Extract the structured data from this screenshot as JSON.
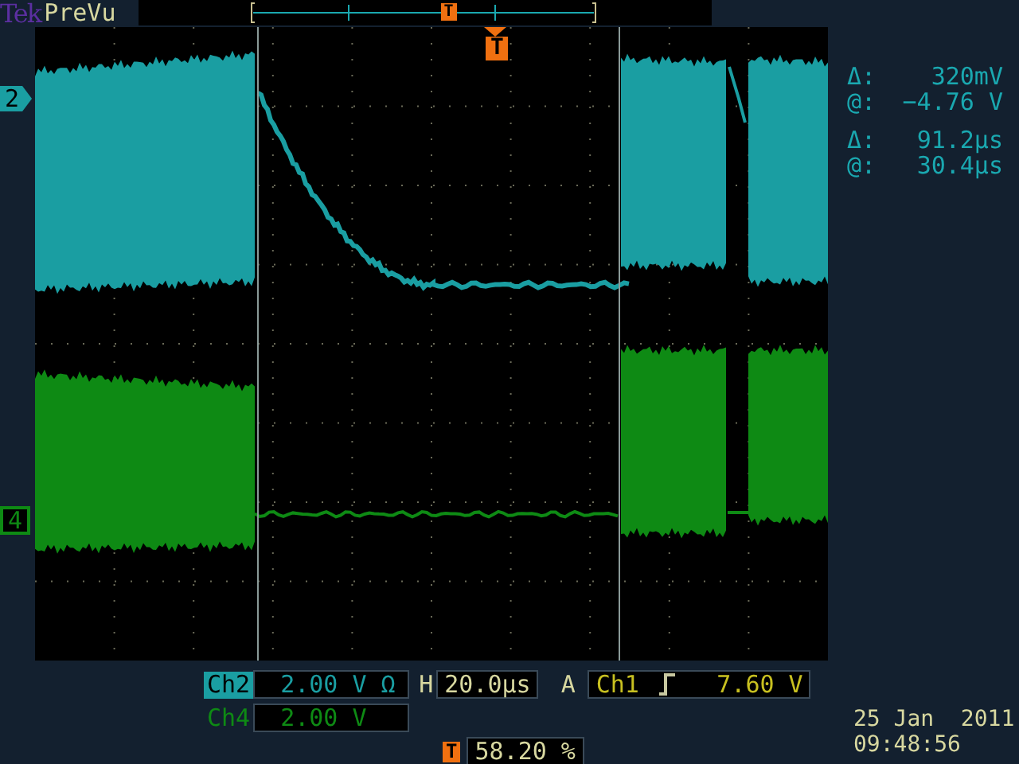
{
  "header": {
    "brand": "Tek",
    "mode": "PreVu"
  },
  "record_view": {
    "trigger_marker": "T"
  },
  "trigger_marker": "T",
  "channel_markers": [
    {
      "label": "2",
      "color": "#1a9ea2"
    },
    {
      "label": "4",
      "color": "#0e8a14"
    }
  ],
  "readouts": [
    {
      "label": "Δ:",
      "value": "320mV"
    },
    {
      "label": "@:",
      "value": "−4.76 V"
    },
    {
      "label": "Δ:",
      "value": "91.2µs"
    },
    {
      "label": "@:",
      "value": "30.4µs"
    }
  ],
  "channels": [
    {
      "name": "Ch2",
      "scale": "2.00 V Ω",
      "selected": true,
      "color": "#1a9ea2"
    },
    {
      "name": "Ch4",
      "scale": "2.00 V",
      "selected": false,
      "color": "#0e8a14"
    }
  ],
  "horizontal": {
    "label": "H",
    "value": "20.0µs"
  },
  "trigger": {
    "label": "A",
    "source": "Ch1",
    "level": "7.60 V"
  },
  "trigger_position": {
    "icon": "T",
    "value": "58.20 %"
  },
  "date": "25 Jan  2011",
  "time": "09:48:56"
}
